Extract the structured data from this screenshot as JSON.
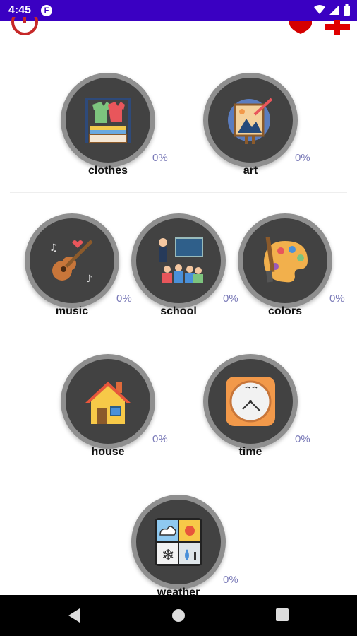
{
  "status_bar": {
    "time": "4:45",
    "notification_icon": "f-app-icon",
    "icons": [
      "wifi-icon",
      "signal-icon",
      "battery-icon"
    ]
  },
  "toolbar": {
    "left_icon": "power-icon",
    "right_icons": [
      "heart-icon",
      "plus-icon"
    ]
  },
  "categories": [
    {
      "label": "clothes",
      "progress": "0%",
      "icon": "clothes-rack-icon"
    },
    {
      "label": "art",
      "progress": "0%",
      "icon": "easel-painting-icon"
    },
    {
      "label": "music",
      "progress": "0%",
      "icon": "guitar-icon"
    },
    {
      "label": "school",
      "progress": "0%",
      "icon": "classroom-icon"
    },
    {
      "label": "colors",
      "progress": "0%",
      "icon": "palette-icon"
    },
    {
      "label": "house",
      "progress": "0%",
      "icon": "house-icon"
    },
    {
      "label": "time",
      "progress": "0%",
      "icon": "clock-icon"
    },
    {
      "label": "weather",
      "progress": "0%",
      "icon": "weather-icon"
    }
  ],
  "nav_bar": {
    "buttons": [
      "back-icon",
      "home-icon",
      "recents-icon"
    ]
  },
  "colors": {
    "status_bar": "#3a00c2",
    "accent_red": "#d50000",
    "ring": "#8f8f8f",
    "disk": "#424242",
    "progress_text": "#7a7ab8"
  }
}
